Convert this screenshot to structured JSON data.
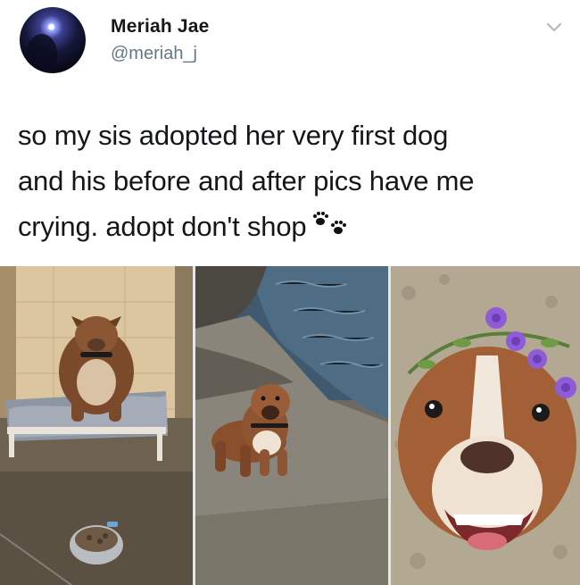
{
  "tweet": {
    "author_name": "Meriah Jae",
    "author_handle": "@meriah_j",
    "text_lines": [
      "so my sis adopted her very first dog",
      "and his before and after pics have me",
      "crying. adopt don't shop"
    ]
  },
  "icons": {
    "avatar": "profile-photo",
    "chevron": "chevron-down-icon",
    "emoji": "paw-prints-icon"
  },
  "photos": [
    {
      "name": "before-photo-shelter-kennel"
    },
    {
      "name": "dog-by-water-photo"
    },
    {
      "name": "dog-with-flower-crown-photo"
    }
  ],
  "colors": {
    "text": "#14171a",
    "secondary_text": "#657786",
    "chevron": "#aab8c2"
  }
}
